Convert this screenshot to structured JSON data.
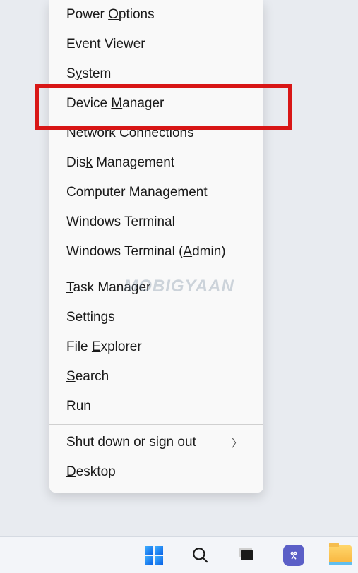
{
  "menu": {
    "groups": [
      [
        {
          "name": "menu-power-options",
          "pre": "Power ",
          "u": "O",
          "post": "ptions",
          "sub": false
        },
        {
          "name": "menu-event-viewer",
          "pre": "Event ",
          "u": "V",
          "post": "iewer",
          "sub": false
        },
        {
          "name": "menu-system",
          "pre": "S",
          "u": "y",
          "post": "stem",
          "sub": false
        },
        {
          "name": "menu-device-manager",
          "pre": "Device ",
          "u": "M",
          "post": "anager",
          "sub": false
        },
        {
          "name": "menu-network-connections",
          "pre": "Net",
          "u": "w",
          "post": "ork Connections",
          "sub": false
        },
        {
          "name": "menu-disk-management",
          "pre": "Dis",
          "u": "k",
          "post": " Management",
          "sub": false
        },
        {
          "name": "menu-computer-management",
          "pre": "Computer Mana",
          "u": "g",
          "post": "ement",
          "sub": false
        },
        {
          "name": "menu-windows-terminal",
          "pre": "W",
          "u": "i",
          "post": "ndows Terminal",
          "sub": false
        },
        {
          "name": "menu-windows-terminal-admin",
          "pre": "Windows Terminal (",
          "u": "A",
          "post": "dmin)",
          "sub": false
        }
      ],
      [
        {
          "name": "menu-task-manager",
          "pre": "",
          "u": "T",
          "post": "ask Manager",
          "sub": false
        },
        {
          "name": "menu-settings",
          "pre": "Setti",
          "u": "n",
          "post": "gs",
          "sub": false
        },
        {
          "name": "menu-file-explorer",
          "pre": "File ",
          "u": "E",
          "post": "xplorer",
          "sub": false
        },
        {
          "name": "menu-search",
          "pre": "",
          "u": "S",
          "post": "earch",
          "sub": false
        },
        {
          "name": "menu-run",
          "pre": "",
          "u": "R",
          "post": "un",
          "sub": false
        }
      ],
      [
        {
          "name": "menu-shutdown-signout",
          "pre": "Sh",
          "u": "u",
          "post": "t down or sign out",
          "sub": true
        },
        {
          "name": "menu-desktop",
          "pre": "",
          "u": "D",
          "post": "esktop",
          "sub": false
        }
      ]
    ]
  },
  "watermark": "MOBIGYAAN"
}
